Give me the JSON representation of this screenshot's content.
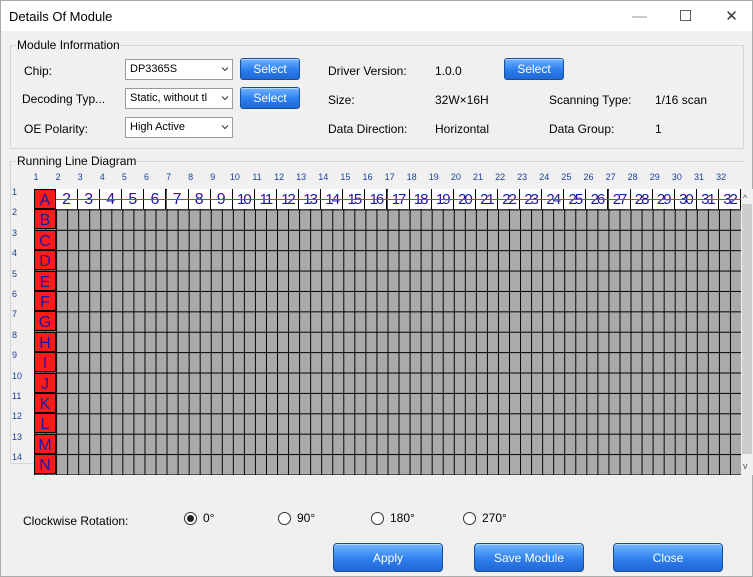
{
  "window": {
    "title": "Details Of Module",
    "minimize": "—",
    "maximize": "☐",
    "close": "✕"
  },
  "module_info": {
    "legend": "Module Information",
    "chip": {
      "label": "Chip:",
      "value": "DP3365S",
      "select": "Select"
    },
    "decoding": {
      "label": "Decoding Typ...",
      "value": "Static, without tl",
      "select": "Select"
    },
    "oe": {
      "label": "OE Polarity:",
      "value": "High Active"
    },
    "driver_version": {
      "label": "Driver Version:",
      "value": "1.0.0",
      "select": "Select"
    },
    "size": {
      "label": "Size:",
      "value": "32W×16H"
    },
    "scanning": {
      "label": "Scanning Type:",
      "value": "1/16 scan"
    },
    "data_direction": {
      "label": "Data Direction:",
      "value": "Horizontal"
    },
    "data_group": {
      "label": "Data Group:",
      "value": "1"
    }
  },
  "diagram": {
    "legend": "Running Line Diagram",
    "columns": [
      "1",
      "2",
      "3",
      "4",
      "5",
      "6",
      "7",
      "8",
      "9",
      "10",
      "11",
      "12",
      "13",
      "14",
      "15",
      "16",
      "17",
      "18",
      "19",
      "20",
      "21",
      "22",
      "23",
      "24",
      "25",
      "26",
      "27",
      "28",
      "29",
      "30",
      "31",
      "32"
    ],
    "rows": [
      "1",
      "2",
      "3",
      "4",
      "5",
      "6",
      "7",
      "8",
      "9",
      "10",
      "11",
      "12",
      "13",
      "14"
    ],
    "row_letters": [
      "A",
      "B",
      "C",
      "D",
      "E",
      "F",
      "G",
      "H",
      "I",
      "J",
      "K",
      "L",
      "M",
      "N"
    ],
    "top_cells": [
      "2",
      "3",
      "4",
      "5",
      "6",
      "7",
      "8",
      "9",
      "10",
      "11",
      "12",
      "13",
      "14",
      "15",
      "16",
      "17",
      "18",
      "19",
      "20",
      "21",
      "22",
      "23",
      "24",
      "25",
      "26",
      "27",
      "28",
      "29",
      "30",
      "31",
      "32"
    ]
  },
  "rotation": {
    "label": "Clockwise Rotation:",
    "options": [
      "0°",
      "90°",
      "180°",
      "270°"
    ],
    "selected": "0°"
  },
  "buttons": {
    "apply": "Apply",
    "save": "Save Module",
    "close": "Close"
  }
}
